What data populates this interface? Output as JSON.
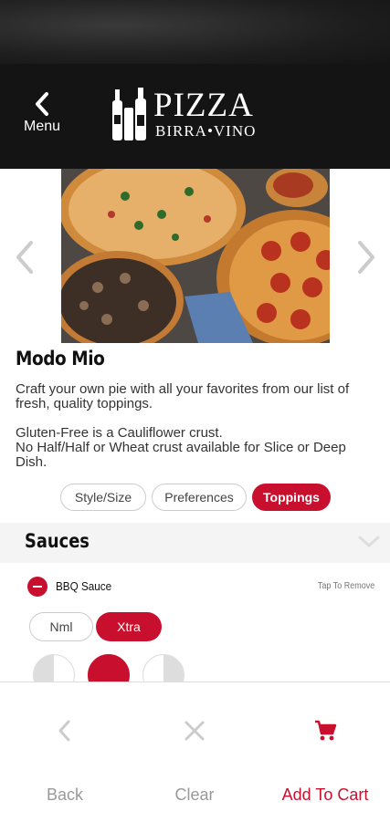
{
  "header": {
    "menu_label": "Menu",
    "logo_title": "PIZZA",
    "logo_subtitle": "BIRRA•VINO"
  },
  "item": {
    "title": "Modo Mio",
    "description": "Craft your own pie with all your favorites from our list of fresh, quality toppings.",
    "note_line1": "Gluten-Free is a Cauliflower crust.",
    "note_line2": "No Half/Half or Wheat crust available for Slice or Deep Dish."
  },
  "tabs": [
    {
      "label": "Style/Size",
      "active": false
    },
    {
      "label": "Preferences",
      "active": false
    },
    {
      "label": "Toppings",
      "active": true
    }
  ],
  "section": {
    "title": "Sauces"
  },
  "topping": {
    "name": "BBQ Sauce",
    "hint": "Tap To Remove",
    "amounts": [
      "Nml",
      "Xtra"
    ],
    "selected_amount": "Xtra",
    "portion_selected": "whole"
  },
  "bottom_nav": {
    "back_label": "Back",
    "clear_label": "Clear",
    "add_label": "Add To Cart"
  },
  "colors": {
    "accent": "#c8102e",
    "header_bg": "#141414"
  },
  "icons": [
    "chevron-left-icon",
    "chevron-right-icon",
    "chevron-down-icon",
    "minus-circle-icon",
    "close-icon",
    "cart-icon",
    "bottles-logo-icon"
  ]
}
